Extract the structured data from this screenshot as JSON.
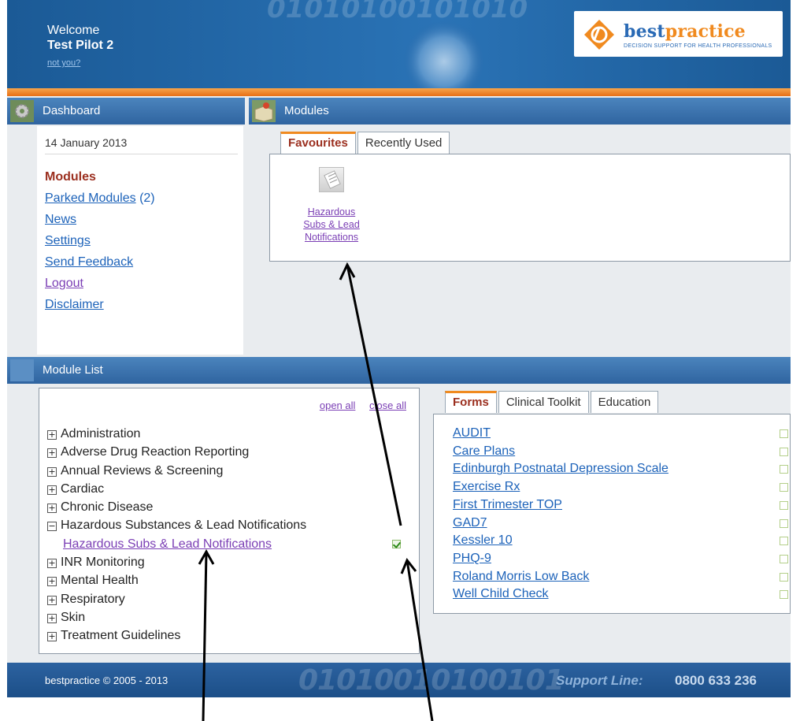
{
  "header": {
    "welcome": "Welcome",
    "user": "Test Pilot 2",
    "not_you": "not you?",
    "brand_part1": "best",
    "brand_part2": "practice",
    "tagline": "DECISION SUPPORT FOR HEALTH PROFESSIONALS"
  },
  "dashboard": {
    "title": "Dashboard",
    "date": "14 January 2013",
    "nav": {
      "modules": "Modules",
      "parked": "Parked Modules",
      "parked_count": "(2)",
      "news": "News",
      "settings": "Settings",
      "feedback": "Send Feedback",
      "logout": "Logout",
      "disclaimer": "Disclaimer"
    }
  },
  "modules": {
    "title": "Modules",
    "tabs": [
      "Favourites",
      "Recently Used"
    ],
    "favourites": [
      {
        "label_line1": "Hazardous",
        "label_line2": "Subs & Lead",
        "label_line3": "Notifications",
        "icon": "form-document-icon"
      }
    ]
  },
  "module_list": {
    "title": "Module List",
    "open_all": "open all",
    "close_all": "close all",
    "tree": [
      {
        "label": "Administration",
        "expanded": false
      },
      {
        "label": "Adverse Drug Reaction Reporting",
        "expanded": false
      },
      {
        "label": "Annual Reviews & Screening",
        "expanded": false
      },
      {
        "label": "Cardiac",
        "expanded": false
      },
      {
        "label": "Chronic Disease",
        "expanded": false
      },
      {
        "label": "Hazardous Substances & Lead Notifications",
        "expanded": true
      },
      {
        "label": "INR Monitoring",
        "expanded": false
      },
      {
        "label": "Mental Health",
        "expanded": false
      },
      {
        "label": "Respiratory",
        "expanded": false
      },
      {
        "label": "Skin",
        "expanded": false
      },
      {
        "label": "Treatment Guidelines",
        "expanded": false
      }
    ],
    "child": {
      "label": "Hazardous Subs & Lead Notifications",
      "favourite_checked": true
    },
    "tabs": [
      "Forms",
      "Clinical Toolkit",
      "Education"
    ],
    "forms": [
      "AUDIT",
      "Care Plans",
      "Edinburgh Postnatal Depression Scale",
      "Exercise Rx",
      "First Trimester TOP",
      "GAD7",
      "Kessler 10",
      "PHQ-9",
      "Roland Morris Low Back",
      "Well Child Check"
    ]
  },
  "footer": {
    "copyright": "bestpractice © 2005 - 2013",
    "digits": "01010010100101",
    "support_label": "Support Line:",
    "support_number": "0800 633 236"
  },
  "colors": {
    "header_blue": "#1f5f99",
    "accent_orange": "#f08a1f",
    "link_blue": "#1c62b9",
    "visited_purple": "#7b3fb5",
    "current_red": "#9b2f1f"
  }
}
